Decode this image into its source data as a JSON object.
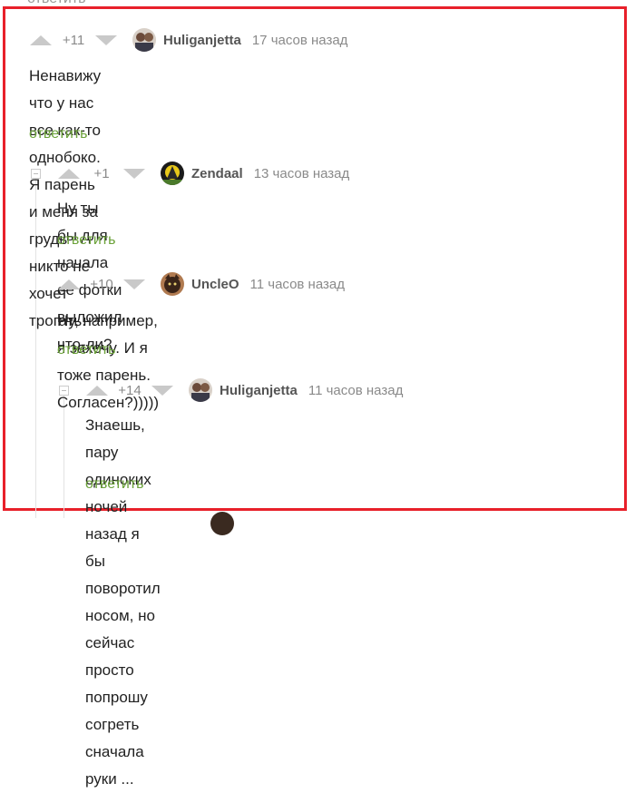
{
  "cutoff_top_text": "ответить",
  "comments": [
    {
      "rating": "+11",
      "username": "Huliganjetta",
      "time": "17 часов назад",
      "text_lines": [
        "Ненавижу что у нас все как-то однобоко. Я парень и меня за грудь никто не",
        "хочет трогать."
      ],
      "reply_label": "ответить"
    },
    {
      "rating": "+1",
      "username": "Zendaal",
      "time": "13 часов назад",
      "text_lines": [
        "Ну ты бы для начала её фотки выложил что-ли?"
      ],
      "reply_label": "ответить"
    },
    {
      "rating": "+10",
      "username": "UncleO",
      "time": "11 часов назад",
      "text_lines": [
        "Ну, например, я захочу. И я тоже парень. Согласен?)))))"
      ],
      "reply_label": "ответить"
    },
    {
      "rating": "+14",
      "username": "Huliganjetta",
      "time": "11 часов назад",
      "text_lines": [
        "Знаешь, пару одиноких ночей назад я бы поворотил носом, но",
        "сейчас просто попрошу согреть сначала руки ..."
      ],
      "reply_label": "ответить"
    }
  ],
  "colors": {
    "frame": "#e8202a",
    "reply": "#6ba239",
    "vote_arrow": "#c9c9c9",
    "meta": "#8a8a8a"
  }
}
